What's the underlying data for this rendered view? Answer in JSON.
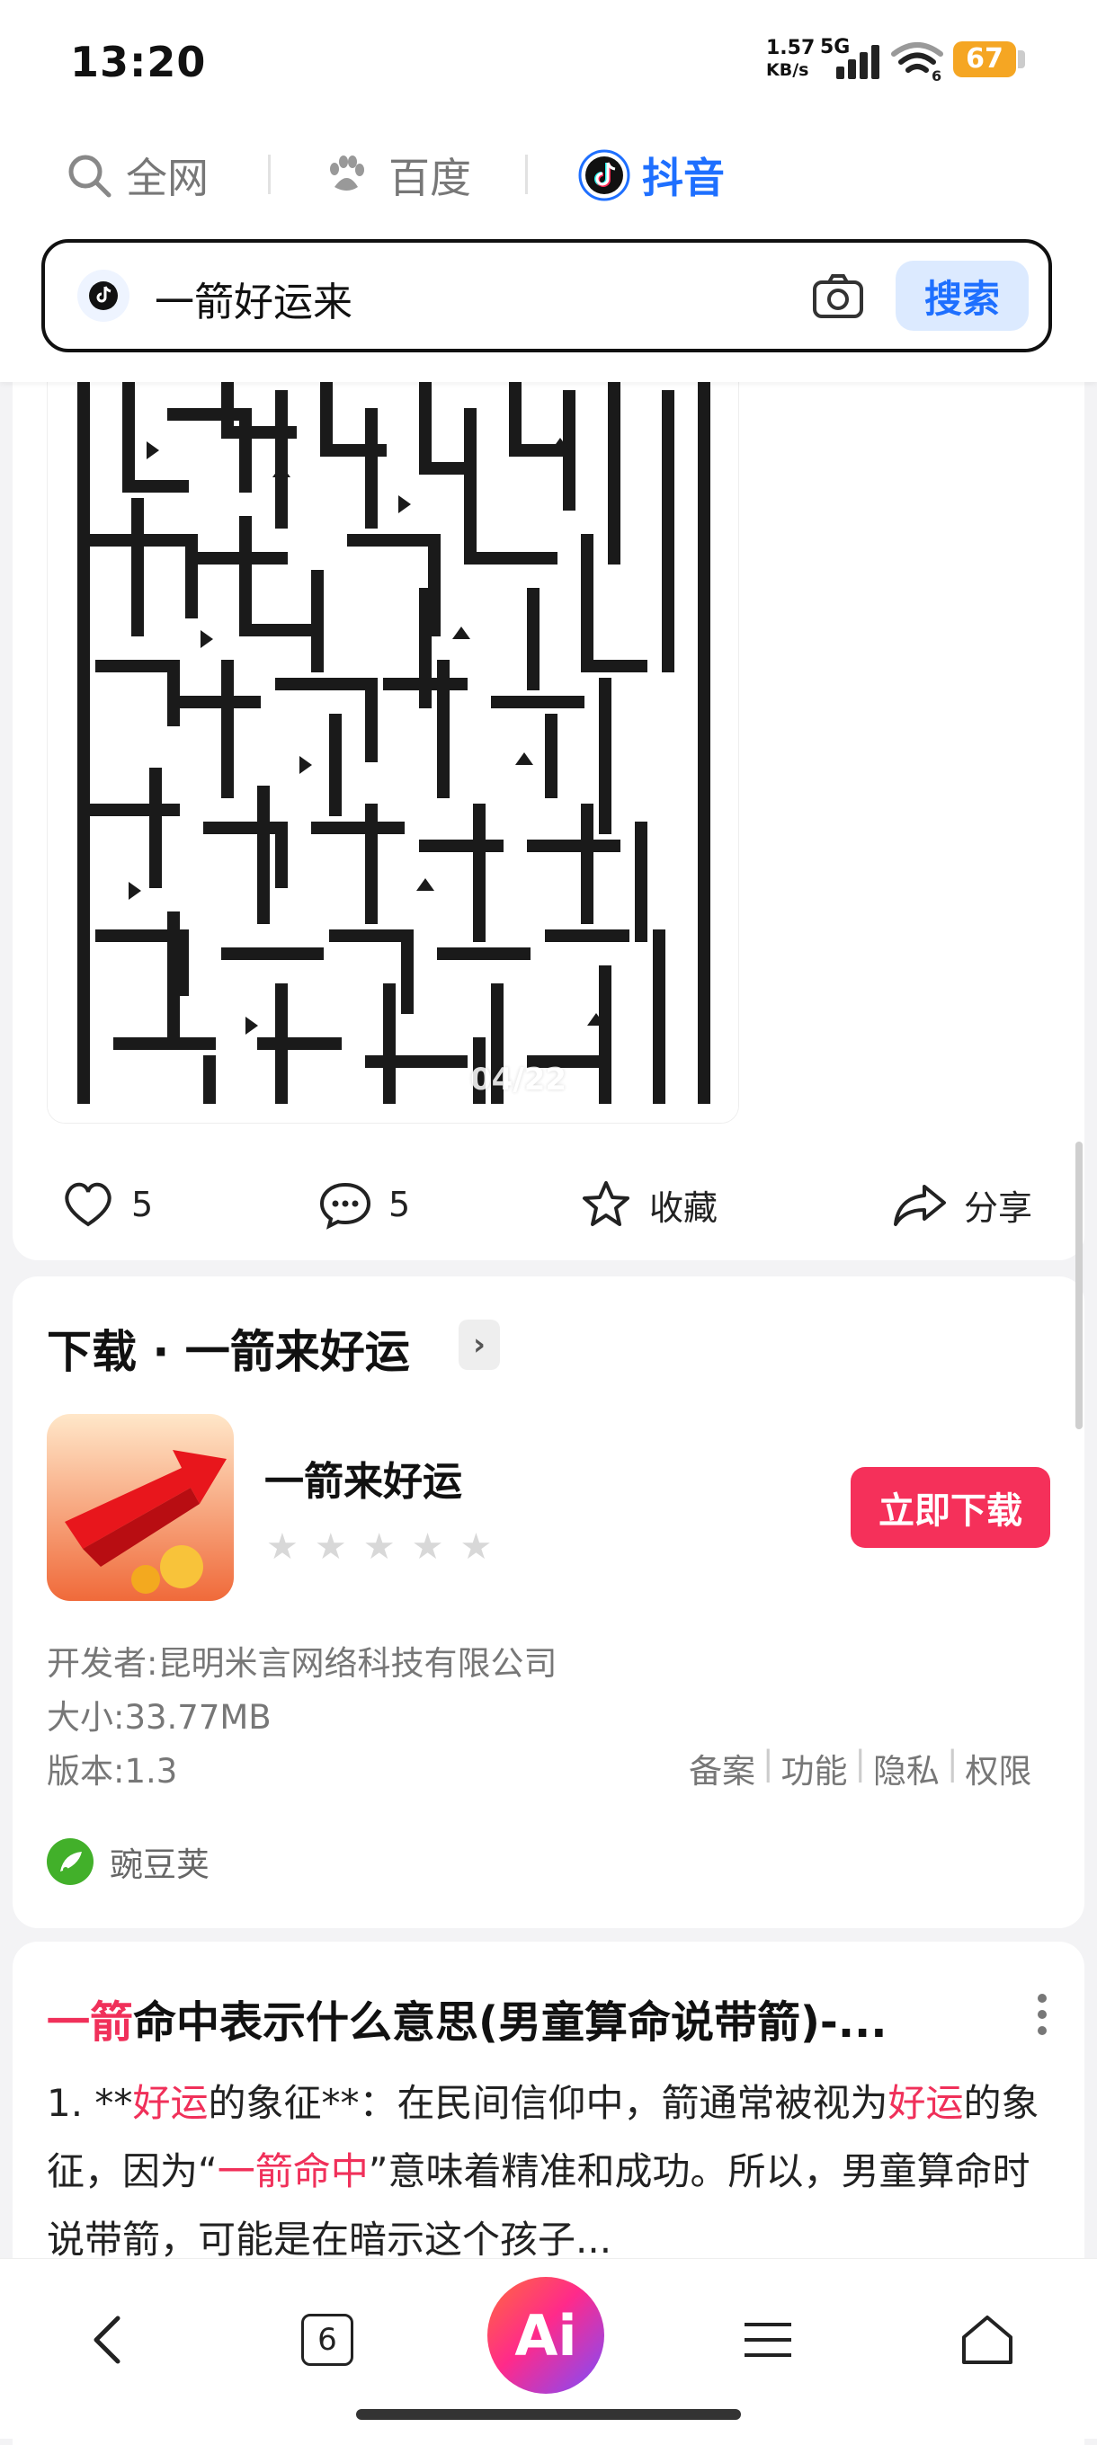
{
  "status": {
    "time": "13:20",
    "net_speed": "1.57",
    "net_unit": "KB/s",
    "network": "5G",
    "wifi_sub": "6",
    "battery": "67"
  },
  "tabs": [
    {
      "label": "全网"
    },
    {
      "label": "百度"
    },
    {
      "label": "抖音"
    }
  ],
  "search": {
    "query": "一箭好运来",
    "button": "搜索"
  },
  "video": {
    "overlay_counter": "04/22",
    "likes": "5",
    "comments": "5",
    "collect": "收藏",
    "share": "分享"
  },
  "download": {
    "title": "下载 · 一箭来好运",
    "app_name": "一箭来好运",
    "button": "立即下载",
    "developer": "开发者:昆明米言网络科技有限公司",
    "size": "大小:33.77MB",
    "version": "版本:1.3",
    "links": [
      "备案",
      "功能",
      "隐私",
      "权限"
    ],
    "source": "豌豆荚",
    "rating_stars": 0
  },
  "result": {
    "title_hl": "一箭",
    "title_rest": "命中表示什么意思(男童算命说带箭)-...",
    "body_p1": "1. **",
    "body_hl1": "好运",
    "body_p2": "的象征**：在民间信仰中，箭通常被视为",
    "body_hl2": "好运",
    "body_p3": "的象征，因为“",
    "body_hl3": "一箭命中",
    "body_p4": "”意味着精准和成功。所以，男童算命时说带箭，可能是在暗示这个孩子..."
  },
  "bottom_nav": {
    "tab_count": "6",
    "ai_label": "Ai"
  }
}
